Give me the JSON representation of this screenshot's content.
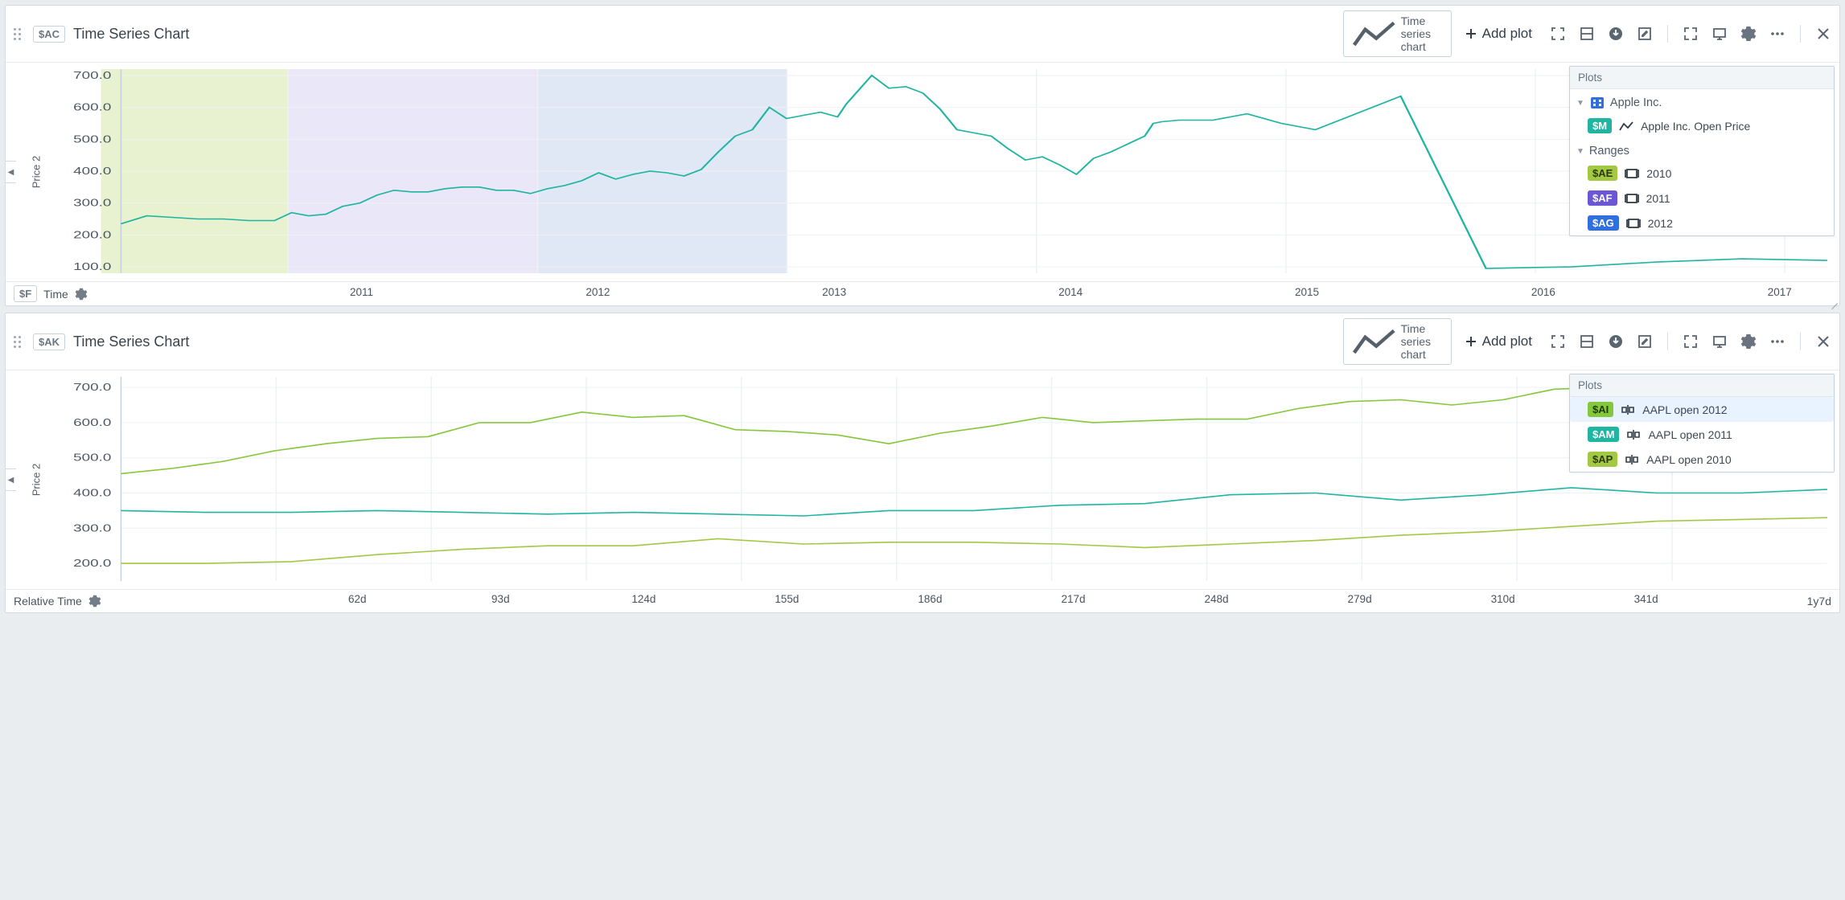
{
  "panels": [
    {
      "tag": "$AC",
      "title": "Time Series Chart",
      "chip_label": "Time series chart",
      "add_plot_label": "Add plot",
      "y_label": "Price 2",
      "x_label": "Time",
      "x_tag": "$F",
      "plots_title": "Plots",
      "group_label": "Apple Inc.",
      "series_item": {
        "tag": "$M",
        "label": "Apple Inc. Open Price",
        "color": "#1fb5a1"
      },
      "ranges_label": "Ranges",
      "ranges": [
        {
          "tag": "$AE",
          "label": "2010",
          "color": "#a3c843"
        },
        {
          "tag": "$AF",
          "label": "2011",
          "color": "#6b57d3"
        },
        {
          "tag": "$AG",
          "label": "2012",
          "color": "#2f6fe0"
        }
      ]
    },
    {
      "tag": "$AK",
      "title": "Time Series Chart",
      "chip_label": "Time series chart",
      "add_plot_label": "Add plot",
      "y_label": "Price 2",
      "x_label": "Relative Time",
      "plots_title": "Plots",
      "items": [
        {
          "tag": "$AI",
          "label": "AAPL open 2012",
          "color": "#86c83b",
          "selected": true
        },
        {
          "tag": "$AM",
          "label": "AAPL open 2011",
          "color": "#1fb5a1"
        },
        {
          "tag": "$AP",
          "label": "AAPL open 2010",
          "color": "#a3c843"
        }
      ]
    }
  ],
  "chart_data": [
    {
      "type": "line",
      "title": "Time Series Chart",
      "ylabel": "Price 2",
      "xlabel": "Time",
      "ylim": [
        80,
        720
      ],
      "xrange": [
        "2010-04",
        "2017-02"
      ],
      "x_tick_labels": [
        "2011",
        "2012",
        "2013",
        "2014",
        "2015",
        "2016",
        "2017"
      ],
      "y_tick_labels": [
        "100.0",
        "200.0",
        "300.0",
        "400.0",
        "500.0",
        "600.0",
        "700.0"
      ],
      "range_bands": [
        {
          "name": "2010",
          "start": "2010-04",
          "end": "2011-01",
          "color": "#cddf96"
        },
        {
          "name": "2011",
          "start": "2011-01",
          "end": "2012-01",
          "color": "#cfc9ef"
        },
        {
          "name": "2012",
          "start": "2012-01",
          "end": "2013-01",
          "color": "#bccbe8"
        }
      ],
      "series": [
        {
          "name": "Apple Inc. Open Price",
          "color": "#1fb5a1",
          "x_fractions": [
            0.0,
            0.015,
            0.03,
            0.045,
            0.06,
            0.075,
            0.09,
            0.1,
            0.11,
            0.12,
            0.13,
            0.14,
            0.15,
            0.16,
            0.17,
            0.18,
            0.19,
            0.2,
            0.21,
            0.22,
            0.23,
            0.24,
            0.25,
            0.26,
            0.27,
            0.28,
            0.29,
            0.3,
            0.31,
            0.32,
            0.33,
            0.34,
            0.35,
            0.36,
            0.37,
            0.38,
            0.39,
            0.4,
            0.41,
            0.42,
            0.425,
            0.43,
            0.44,
            0.45,
            0.46,
            0.47,
            0.48,
            0.49,
            0.5,
            0.51,
            0.52,
            0.53,
            0.54,
            0.55,
            0.56,
            0.57,
            0.58,
            0.6,
            0.605,
            0.61,
            0.62,
            0.64,
            0.66,
            0.68,
            0.7,
            0.75,
            0.8,
            0.85,
            0.9,
            0.95,
            1.0
          ],
          "y_values": [
            235,
            260,
            255,
            250,
            250,
            245,
            245,
            270,
            260,
            265,
            290,
            300,
            325,
            340,
            335,
            335,
            345,
            350,
            350,
            340,
            340,
            330,
            345,
            355,
            370,
            395,
            375,
            390,
            400,
            395,
            385,
            405,
            460,
            510,
            530,
            600,
            565,
            575,
            585,
            570,
            610,
            640,
            700,
            660,
            665,
            645,
            595,
            530,
            520,
            510,
            470,
            435,
            445,
            420,
            390,
            440,
            460,
            510,
            550,
            555,
            560,
            560,
            580,
            550,
            530,
            635,
            95,
            100,
            115,
            125,
            120
          ]
        }
      ]
    },
    {
      "type": "line",
      "title": "Time Series Chart",
      "ylabel": "Price 2",
      "xlabel": "Relative Time",
      "ylim": [
        150,
        730
      ],
      "x_tick_labels": [
        "62d",
        "93d",
        "124d",
        "155d",
        "186d",
        "217d",
        "248d",
        "279d",
        "310d",
        "341d"
      ],
      "x_right_label": "1y7d",
      "y_tick_labels": [
        "200.0",
        "300.0",
        "400.0",
        "500.0",
        "600.0",
        "700.0"
      ],
      "series": [
        {
          "name": "AAPL open 2012",
          "color": "#86c83b",
          "x_fractions": [
            0.0,
            0.03,
            0.06,
            0.09,
            0.12,
            0.15,
            0.18,
            0.21,
            0.24,
            0.27,
            0.3,
            0.33,
            0.36,
            0.39,
            0.42,
            0.45,
            0.48,
            0.51,
            0.54,
            0.57,
            0.6,
            0.63,
            0.66,
            0.69,
            0.72,
            0.75,
            0.78,
            0.81,
            0.84,
            0.87,
            0.9,
            0.93,
            0.96,
            1.0
          ],
          "y_values": [
            455,
            470,
            490,
            520,
            540,
            555,
            560,
            600,
            600,
            630,
            615,
            620,
            580,
            575,
            565,
            540,
            570,
            590,
            615,
            600,
            605,
            610,
            610,
            640,
            660,
            665,
            650,
            665,
            695,
            700,
            680,
            655,
            640,
            620
          ]
        },
        {
          "name": "AAPL open 2011",
          "color": "#1fb5a1",
          "x_fractions": [
            0.0,
            0.05,
            0.1,
            0.15,
            0.2,
            0.25,
            0.3,
            0.35,
            0.4,
            0.45,
            0.5,
            0.55,
            0.6,
            0.65,
            0.7,
            0.75,
            0.8,
            0.85,
            0.9,
            0.95,
            1.0
          ],
          "y_values": [
            350,
            345,
            345,
            350,
            345,
            340,
            345,
            340,
            335,
            350,
            350,
            365,
            370,
            395,
            400,
            380,
            395,
            415,
            400,
            400,
            410
          ]
        },
        {
          "name": "AAPL open 2010",
          "color": "#a3c843",
          "x_fractions": [
            0.0,
            0.05,
            0.1,
            0.15,
            0.2,
            0.25,
            0.3,
            0.35,
            0.4,
            0.45,
            0.5,
            0.55,
            0.6,
            0.65,
            0.7,
            0.75,
            0.8,
            0.85,
            0.9,
            0.95,
            1.0
          ],
          "y_values": [
            200,
            200,
            205,
            225,
            240,
            250,
            250,
            270,
            255,
            260,
            260,
            255,
            245,
            255,
            265,
            280,
            290,
            305,
            320,
            325,
            330
          ]
        }
      ]
    }
  ]
}
